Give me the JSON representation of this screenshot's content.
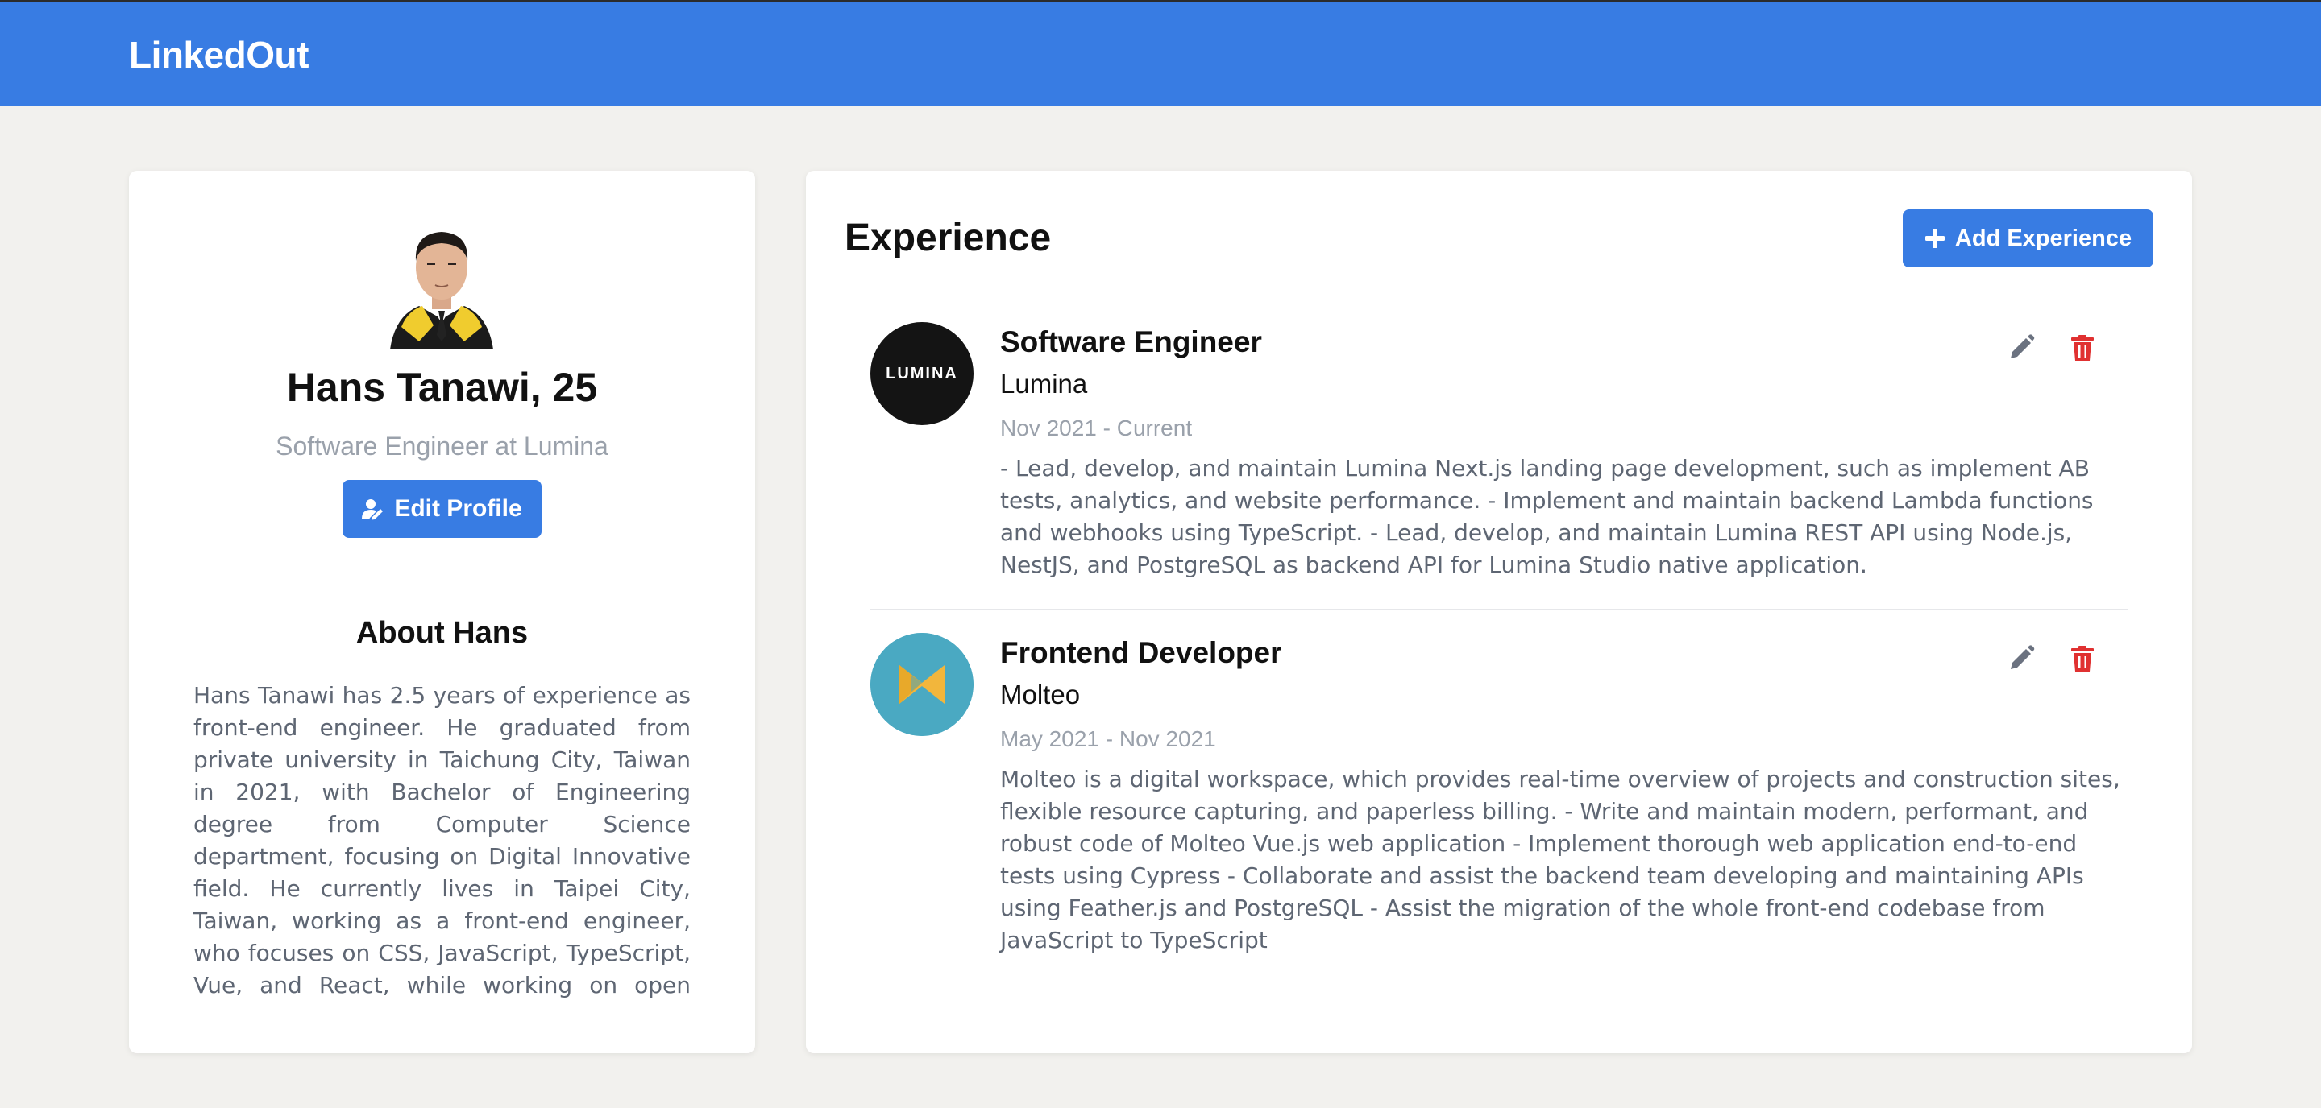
{
  "app": {
    "brand": "LinkedOut"
  },
  "profile": {
    "name": "Hans Tanawi, 25",
    "headline": "Software Engineer at Lumina",
    "edit_button": "Edit Profile",
    "about_title": "About Hans",
    "about_text": "Hans Tanawi has 2.5 years of experience as front-end engineer. He graduated from private university in Taichung City, Taiwan in 2021, with Bachelor of Engineering degree from Computer Science department, focusing on Digital Innovative field. He currently lives in Taipei City, Taiwan, working as a front-end engineer, who focuses on CSS, JavaScript, TypeScript, Vue, and React, while working on open source projects and learning other technologies such"
  },
  "experience": {
    "title": "Experience",
    "add_button": "Add Experience",
    "items": [
      {
        "title": "Software Engineer",
        "company": "Lumina",
        "logo_text": "LUMINA",
        "period": "Nov 2021 - Current",
        "description": "- Lead, develop, and maintain Lumina Next.js landing page development, such as implement AB tests, analytics, and website performance. - Implement and maintain backend Lambda functions and webhooks using TypeScript. - Lead, develop, and maintain Lumina REST API using Node.js, NestJS, and PostgreSQL as backend API for Lumina Studio native application."
      },
      {
        "title": "Frontend Developer",
        "company": "Molteo",
        "period": "May 2021 - Nov 2021",
        "description": "Molteo is a digital workspace, which provides real-time overview of projects and construction sites, flexible resource capturing, and paperless billing. - Write and maintain modern, performant, and robust code of Molteo Vue.js web application - Implement thorough web application end-to-end tests using Cypress - Collaborate and assist the backend team developing and maintaining APIs using Feather.js and PostgreSQL - Assist the migration of the whole front-end codebase from JavaScript to TypeScript"
      }
    ]
  },
  "icons": {
    "edit_profile": "user-pen-icon",
    "add": "plus-icon",
    "edit": "pencil-icon",
    "delete": "trash-icon"
  },
  "colors": {
    "primary": "#387ce3",
    "danger": "#e03131",
    "muted": "#9aa1ab",
    "body_text": "#5e6673"
  }
}
